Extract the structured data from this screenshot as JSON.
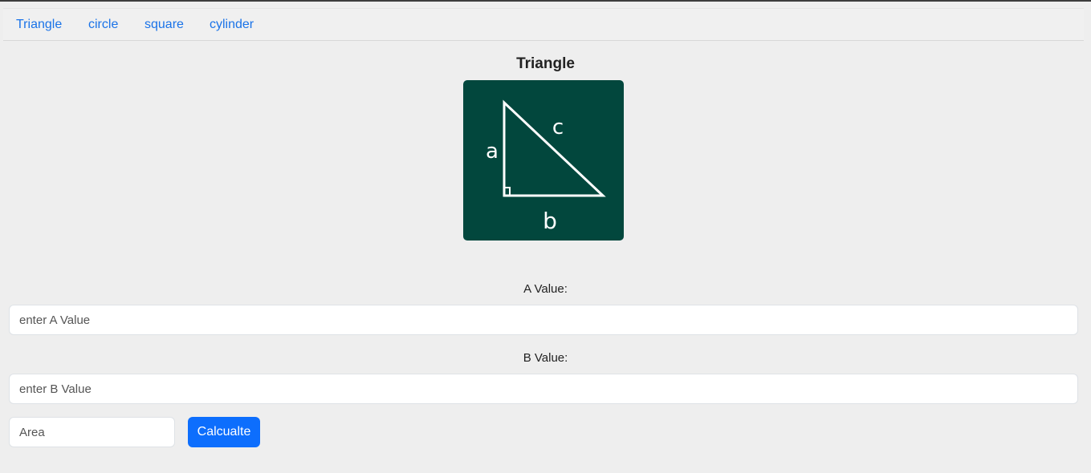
{
  "nav": {
    "items": [
      {
        "label": "Triangle"
      },
      {
        "label": "circle"
      },
      {
        "label": "square"
      },
      {
        "label": "cylinder"
      }
    ]
  },
  "main": {
    "title": "Triangle",
    "figure": {
      "side_a": "a",
      "side_b": "b",
      "side_c": "c"
    },
    "a_label": "A Value:",
    "a_placeholder": "enter A Value",
    "b_label": "B Value:",
    "b_placeholder": "enter B Value",
    "area_placeholder": "Area",
    "calculate_label": "Calcualte"
  },
  "colors": {
    "figure_bg": "#02473d",
    "link": "#1a73e8",
    "primary_button": "#0d6efd"
  }
}
